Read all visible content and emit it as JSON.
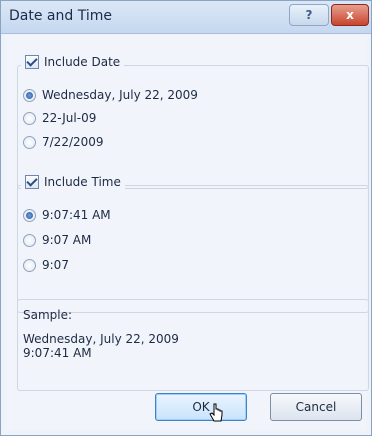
{
  "window": {
    "title": "Date and Time"
  },
  "titlebar": {
    "help_icon": "?",
    "close_icon": "x"
  },
  "include_date": {
    "label": "Include Date",
    "checked": true,
    "options": [
      {
        "label": "Wednesday, July 22, 2009",
        "selected": true
      },
      {
        "label": "22-Jul-09",
        "selected": false
      },
      {
        "label": "7/22/2009",
        "selected": false
      }
    ]
  },
  "include_time": {
    "label": "Include Time",
    "checked": true,
    "options": [
      {
        "label": "9:07:41 AM",
        "selected": true
      },
      {
        "label": "9:07 AM",
        "selected": false
      },
      {
        "label": "9:07",
        "selected": false
      }
    ]
  },
  "sample": {
    "label": "Sample:",
    "text": "Wednesday, July 22, 2009\n9:07:41 AM"
  },
  "buttons": {
    "ok": "OK",
    "cancel": "Cancel"
  },
  "colors": {
    "titlebar": "#c5d8ef",
    "close": "#c7452e",
    "accent": "#3f80c7"
  }
}
